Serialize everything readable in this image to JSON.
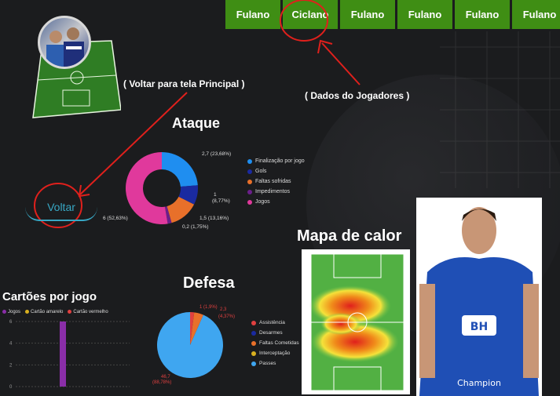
{
  "nav": {
    "tabs": [
      "Fulano",
      "Ciclano",
      "Fulano",
      "Fulano",
      "Fulano",
      "Fulano"
    ]
  },
  "annotations": {
    "back_hint": "( Voltar para tela Principal )",
    "players_hint": "( Dados do Jogadores )"
  },
  "back_button": {
    "label": "Voltar"
  },
  "colors": {
    "tab_green": "#3f8e14",
    "annotation_red": "#e0201c",
    "accent_cyan": "#38a7c4"
  },
  "attack": {
    "title": "Ataque",
    "legend": [
      {
        "label": "Finalização por jogo",
        "color": "#1f8ef0"
      },
      {
        "label": "Gols",
        "color": "#1a2aa0"
      },
      {
        "label": "Faltas sofridas",
        "color": "#e8702a"
      },
      {
        "label": "Impedimentos",
        "color": "#6b1f8a"
      },
      {
        "label": "Jogos",
        "color": "#e0399c"
      }
    ],
    "labels": [
      "2,7 (23,68%)",
      "1",
      "(8,77%)",
      "1,5 (13,16%)",
      "0,2 (1,75%)",
      "6 (52,63%)"
    ]
  },
  "heatmap_title": "Mapa de calor",
  "defense": {
    "title": "Defesa",
    "legend": [
      {
        "label": "Assistência",
        "color": "#e04040"
      },
      {
        "label": "Desarmes",
        "color": "#1a2aa0"
      },
      {
        "label": "Faltas Cometidas",
        "color": "#e8702a"
      },
      {
        "label": "Interceptação",
        "color": "#d8b020"
      },
      {
        "label": "Passes",
        "color": "#3fa6f0"
      }
    ],
    "labels": [
      "1 (1,9%)",
      "2,3",
      "(4,37%)",
      "46,7",
      "(88,78%)"
    ]
  },
  "cards": {
    "title": "Cartões por jogo",
    "legend": [
      {
        "label": "Jogos",
        "color": "#8a2ea8"
      },
      {
        "label": "Cartão amarelo",
        "color": "#d8b020"
      },
      {
        "label": "Cartão vermelho",
        "color": "#e04040"
      }
    ],
    "ticks": [
      "6",
      "4",
      "2",
      "0"
    ]
  },
  "chart_data": [
    {
      "type": "pie",
      "title": "Ataque",
      "categories": [
        "Finalização por jogo",
        "Gols",
        "Faltas sofridas",
        "Impedimentos",
        "Jogos"
      ],
      "values": [
        2.7,
        1,
        1.5,
        0.2,
        6
      ],
      "percent": [
        23.68,
        8.77,
        13.16,
        1.75,
        52.63
      ],
      "donut": true,
      "legend": "right"
    },
    {
      "type": "pie",
      "title": "Defesa",
      "categories": [
        "Assistência",
        "Desarmes",
        "Faltas Cometidas",
        "Interceptação",
        "Passes"
      ],
      "values": [
        1,
        0,
        2.3,
        0,
        46.7
      ],
      "percent": [
        1.9,
        0,
        4.37,
        0,
        88.78
      ],
      "legend": "right"
    },
    {
      "type": "bar",
      "title": "Cartões por jogo",
      "series": [
        {
          "name": "Jogos",
          "values": [
            6
          ]
        },
        {
          "name": "Cartão amarelo",
          "values": [
            0
          ]
        },
        {
          "name": "Cartão vermelho",
          "values": [
            0
          ]
        }
      ],
      "ylim": [
        0,
        6
      ],
      "legend": "top-left"
    }
  ]
}
